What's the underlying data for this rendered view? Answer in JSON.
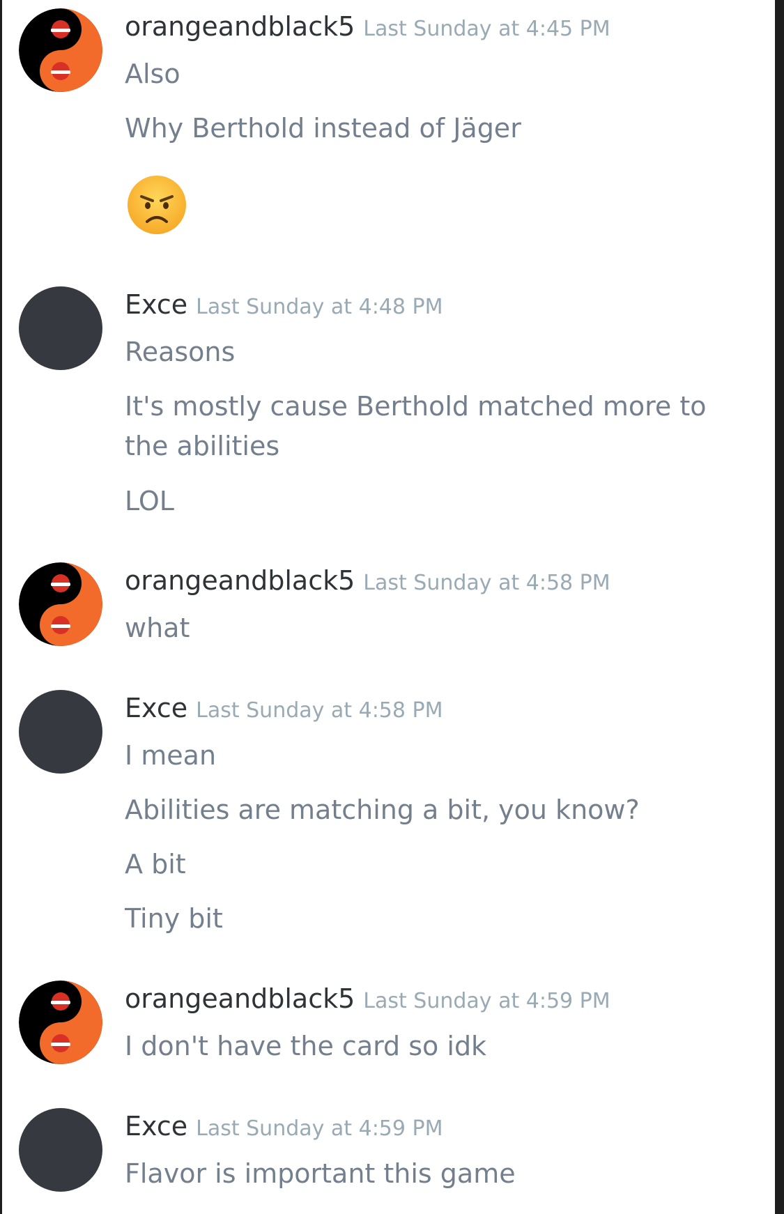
{
  "conversation": {
    "groups": [
      {
        "author": "orangeandblack5",
        "timestamp": "Last Sunday at 4:45 PM",
        "avatar_icon": "yin-yang-santa-hat-icon",
        "messages": [
          "Also",
          "Why Berthold instead of Jäger"
        ],
        "emoji": "angry-face-icon"
      },
      {
        "author": "Exce",
        "timestamp": "Last Sunday at 4:48 PM",
        "avatar_icon": "default-dark-avatar",
        "messages": [
          "Reasons",
          "It's mostly cause Berthold matched more to the abilities",
          "LOL"
        ]
      },
      {
        "author": "orangeandblack5",
        "timestamp": "Last Sunday at 4:58 PM",
        "avatar_icon": "yin-yang-santa-hat-icon",
        "messages": [
          "what"
        ]
      },
      {
        "author": "Exce",
        "timestamp": "Last Sunday at 4:58 PM",
        "avatar_icon": "default-dark-avatar",
        "messages": [
          "I mean",
          "Abilities are matching a bit, you know?",
          "A bit",
          "Tiny bit"
        ]
      },
      {
        "author": "orangeandblack5",
        "timestamp": "Last Sunday at 4:59 PM",
        "avatar_icon": "yin-yang-santa-hat-icon",
        "messages": [
          "I don't have the card so idk"
        ]
      },
      {
        "author": "Exce",
        "timestamp": "Last Sunday at 4:59 PM",
        "avatar_icon": "default-dark-avatar",
        "messages": [
          "Flavor is important this game"
        ]
      }
    ]
  },
  "colors": {
    "username": "#2e3338",
    "timestamp": "#99aab5",
    "message_text": "#747f8d",
    "dark_avatar": "#36393f",
    "orange": "#f26b2a"
  }
}
